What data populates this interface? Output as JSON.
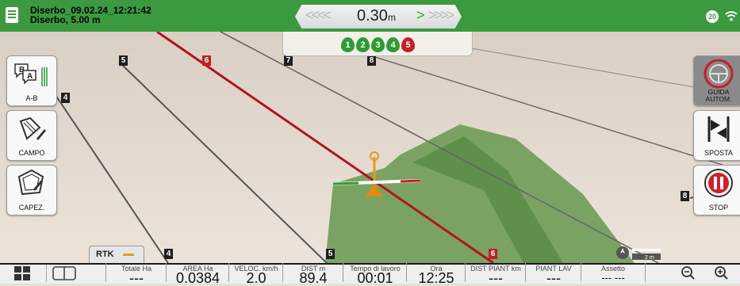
{
  "header": {
    "job_name": "Diserbo_09.02.24_12:21:42",
    "job_sub": "Diserbo, 5.00 m",
    "offset_value": "0.30",
    "offset_unit": "m",
    "left_arrows": "<<<<",
    "right_arrows": ">>>>",
    "green_arrow": ">",
    "sat_badge": "20"
  },
  "sections": [
    "1",
    "2",
    "3",
    "4",
    "5"
  ],
  "section_colors": [
    "#2e9b34",
    "#2e9b34",
    "#2e9b34",
    "#2e9b34",
    "#c3202a"
  ],
  "lines": {
    "top": [
      "5",
      "6",
      "7",
      "8"
    ],
    "left": "4",
    "right": "8",
    "bottom": [
      "4",
      "5",
      "6"
    ]
  },
  "left_panel": [
    {
      "label": "A-B",
      "icon": "ab-line-icon"
    },
    {
      "label": "CAMPO",
      "icon": "field-edit-icon"
    },
    {
      "label": "CAPEZ.",
      "icon": "headland-icon"
    }
  ],
  "right_panel": [
    {
      "label": "GUIDA AUTOM.",
      "icon": "steering-wheel-icon"
    },
    {
      "label": "SPOSTA",
      "icon": "shift-line-icon"
    },
    {
      "label": "STOP",
      "icon": "pause-icon"
    }
  ],
  "rtk_label": "RTK",
  "scale_label": "2 m",
  "stats": [
    {
      "label": "Totale Ha",
      "value": "---"
    },
    {
      "label": "AREA Ha",
      "value": "0.0384"
    },
    {
      "label": "VELOC. km/h",
      "value": "2.0"
    },
    {
      "label": "DIST m",
      "value": "89.4"
    },
    {
      "label": "Tempo di lavoro",
      "value": "00:01"
    },
    {
      "label": "Ora",
      "value": "12:25"
    },
    {
      "label": "DIST PIANT km",
      "value": "---"
    },
    {
      "label": "PIANT LAV",
      "value": "---"
    },
    {
      "label": "Assetto",
      "value": "---   ---"
    }
  ],
  "colors": {
    "header_green": "#3b9a3f",
    "ground": "#e9dfd4",
    "coverage": "#6a9a52",
    "active_line": "#c3202a"
  }
}
